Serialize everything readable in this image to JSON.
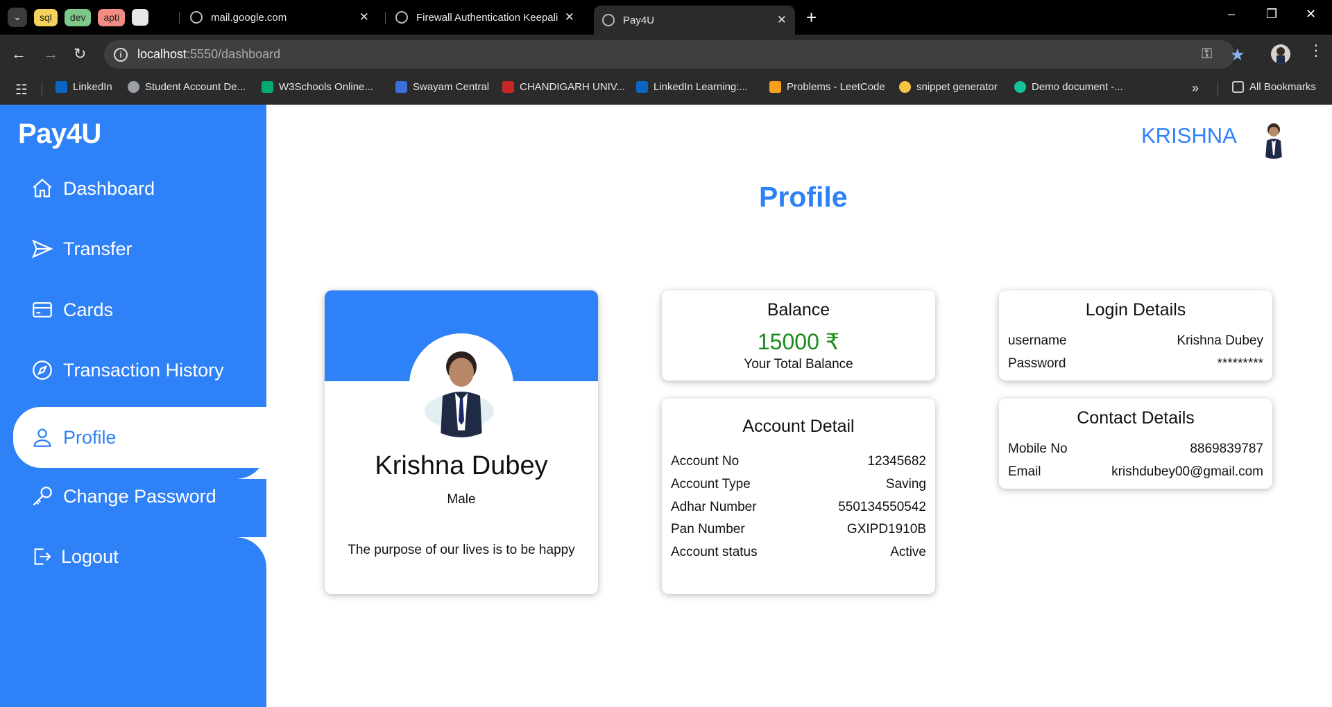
{
  "browser": {
    "groups": [
      {
        "label": "sql",
        "bg": "#f5d35a",
        "fg": "#222"
      },
      {
        "label": "dev",
        "bg": "#7ec98a",
        "fg": "#222"
      },
      {
        "label": "apti",
        "bg": "#f28b82",
        "fg": "#222"
      }
    ],
    "tabs": [
      {
        "title": "mail.google.com"
      },
      {
        "title": "Firewall Authentication Keepalive"
      },
      {
        "title": "Pay4U"
      }
    ],
    "url_host": "localhost",
    "url_rest": ":5550/dashboard",
    "bookmarks": [
      {
        "label": "LinkedIn",
        "color": "#0a66c2"
      },
      {
        "label": "Student Account De...",
        "color": "#9aa0a6"
      },
      {
        "label": "W3Schools Online...",
        "color": "#04aa6d"
      },
      {
        "label": "Swayam Central",
        "color": "#3b6fd8"
      },
      {
        "label": "CHANDIGARH UNIV...",
        "color": "#c62828"
      },
      {
        "label": "LinkedIn Learning:...",
        "color": "#0a66c2"
      },
      {
        "label": "Problems - LeetCode",
        "color": "#f89f1b"
      },
      {
        "label": "snippet generator",
        "color": "#f5c542"
      },
      {
        "label": "Demo document -...",
        "color": "#15c39a"
      }
    ],
    "all_bookmarks": "All Bookmarks"
  },
  "app": {
    "brand": "Pay4U",
    "nav": [
      {
        "label": "Dashboard",
        "icon": "home-icon"
      },
      {
        "label": "Transfer",
        "icon": "send-icon"
      },
      {
        "label": "Cards",
        "icon": "card-icon"
      },
      {
        "label": "Transaction History",
        "icon": "compass-icon"
      },
      {
        "label": "Profile",
        "icon": "user-icon"
      },
      {
        "label": "Change Password",
        "icon": "key-icon"
      },
      {
        "label": "Logout",
        "icon": "logout-icon"
      }
    ],
    "active_nav": "Profile",
    "header_user": "KRISHNA",
    "page_title": "Profile",
    "accent": "#2f81f7"
  },
  "profile": {
    "name": "Krishna Dubey",
    "gender": "Male",
    "bio": "The purpose of our lives is to be happy"
  },
  "balance": {
    "title": "Balance",
    "amount": "15000 ₹",
    "subtitle": "Your Total Balance",
    "amount_color": "#1a8a1a"
  },
  "account": {
    "title": "Account Detail",
    "rows": [
      {
        "label": "Account No",
        "value": "12345682"
      },
      {
        "label": "Account Type",
        "value": "Saving"
      },
      {
        "label": "Adhar Number",
        "value": "550134550542"
      },
      {
        "label": "Pan Number",
        "value": "GXIPD1910B"
      },
      {
        "label": "Account status",
        "value": "Active"
      }
    ]
  },
  "login": {
    "title": "Login Details",
    "rows": [
      {
        "label": "username",
        "value": "Krishna Dubey"
      },
      {
        "label": "Password",
        "value": "*********"
      }
    ]
  },
  "contact": {
    "title": "Contact Details",
    "rows": [
      {
        "label": "Mobile No",
        "value": "8869839787"
      },
      {
        "label": "Email",
        "value": "krishdubey00@gmail.com"
      }
    ]
  }
}
